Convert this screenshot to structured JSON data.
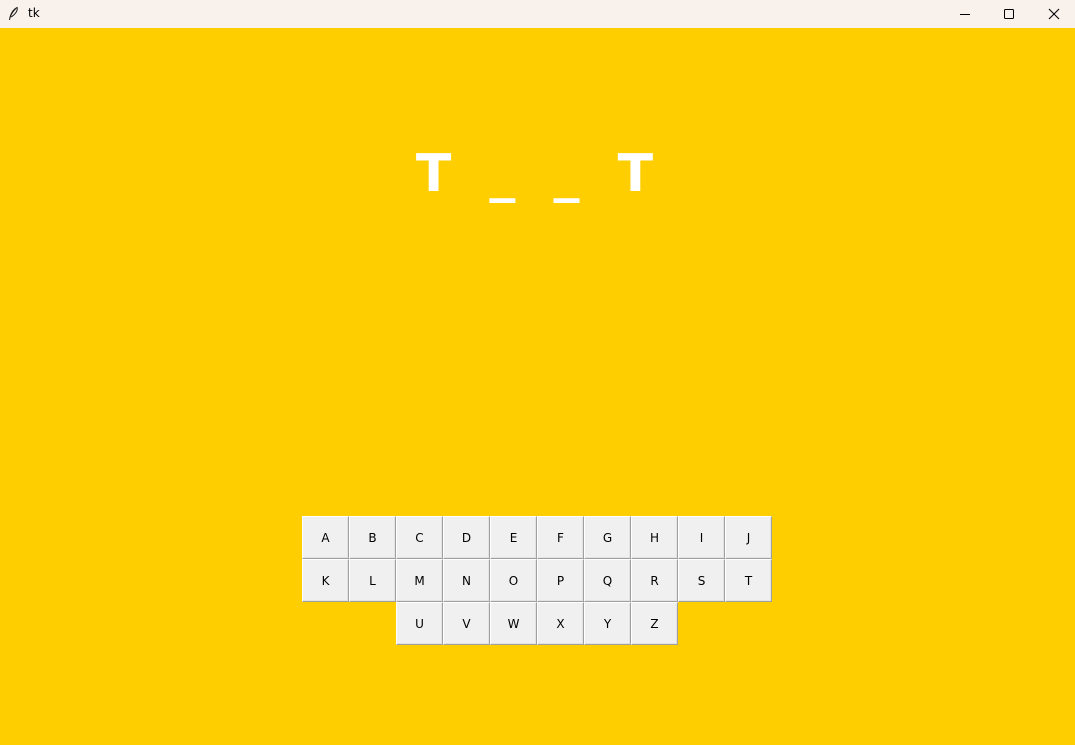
{
  "window": {
    "title": "tk",
    "background": "#FFCE00",
    "titlebar_background": "#F8F1EC",
    "controls": {
      "minimize_icon": "minimize-icon",
      "maximize_icon": "maximize-icon",
      "close_icon": "close-icon"
    }
  },
  "game": {
    "word_display": "T _ _ T",
    "word_color": "#FFFFFF"
  },
  "keyboard": {
    "rows": [
      [
        "A",
        "B",
        "C",
        "D",
        "E",
        "F",
        "G",
        "H",
        "I",
        "J"
      ],
      [
        "K",
        "L",
        "M",
        "N",
        "O",
        "P",
        "Q",
        "R",
        "S",
        "T"
      ],
      [
        "U",
        "V",
        "W",
        "X",
        "Y",
        "Z"
      ]
    ]
  }
}
